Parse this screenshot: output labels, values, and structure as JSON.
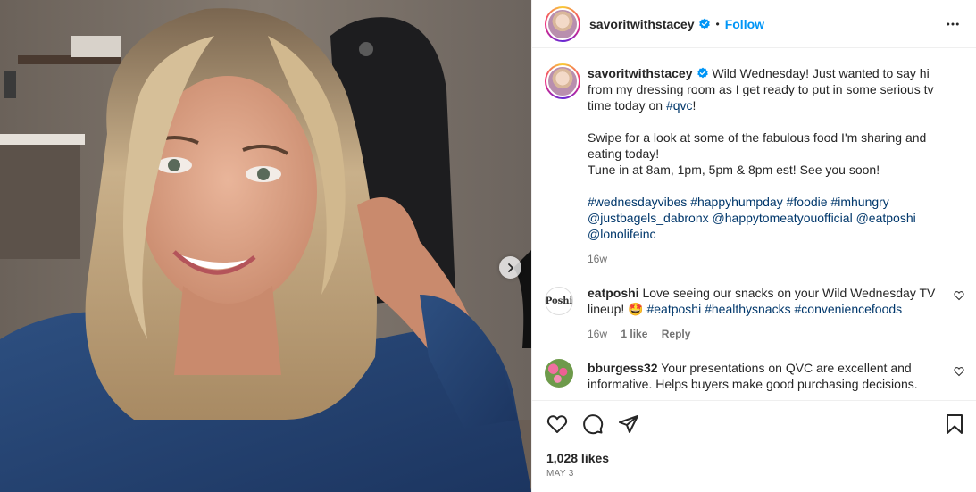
{
  "account": {
    "username": "savoritwithstacey",
    "follow_label": "Follow",
    "dot": "•"
  },
  "caption": {
    "username": "savoritwithstacey",
    "line1": "Wild Wednesday! Just wanted to say hi from my dressing room as I get ready to put in some serious tv time today on ",
    "tag_qvc": "#qvc",
    "line1_end": "!",
    "para2": "Swipe for a look at some of the fabulous food I'm sharing and eating today!",
    "para3": "Tune in at 8am, 1pm, 5pm & 8pm est! See you soon!",
    "hashtags": [
      "#wednesdayvibes",
      "#happyhumpday",
      "#foodie",
      "#imhungry"
    ],
    "mentions": [
      "@justbagels_dabronx",
      "@happytomeatyouofficial",
      "@eatposhi",
      "@lonolifeinc"
    ],
    "time": "16w"
  },
  "comments": [
    {
      "username": "eatposhi",
      "avatar_text": "Poshi",
      "text": "Love seeing our snacks on your Wild Wednesday TV lineup!",
      "emoji": "🤩",
      "tags": [
        "#eatposhi",
        "#healthysnacks",
        "#conveniencefoods"
      ],
      "time": "16w",
      "likes": "1 like",
      "reply_label": "Reply"
    },
    {
      "username": "bburgess32",
      "text": "Your presentations on QVC are excellent and informative. Helps buyers make good purchasing decisions."
    }
  ],
  "post": {
    "likes": "1,028 likes",
    "date": "MAY 3"
  },
  "icons": {
    "more": "more-options-icon",
    "like": "heart-icon",
    "comment": "comment-icon",
    "share": "share-icon",
    "save": "bookmark-icon",
    "next": "chevron-right-icon",
    "verified": "verified-badge-icon"
  },
  "colors": {
    "link": "#00376b",
    "follow": "#0095f6",
    "verified": "#0095f6",
    "muted": "#737373"
  }
}
